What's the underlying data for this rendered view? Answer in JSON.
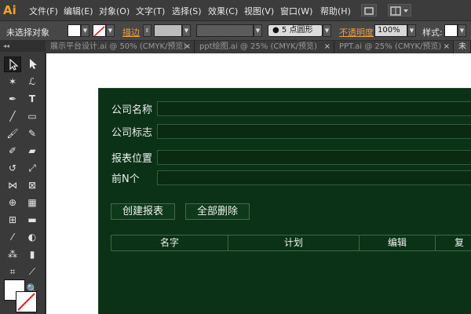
{
  "app": {
    "logo": "Ai"
  },
  "menu": {
    "items": [
      "文件(F)",
      "编辑(E)",
      "对象(O)",
      "文字(T)",
      "选择(S)",
      "效果(C)",
      "视图(V)",
      "窗口(W)",
      "帮助(H)"
    ]
  },
  "control": {
    "no_selection": "未选择对象",
    "stroke_label": "描边",
    "brush_label": "5 点圆形",
    "opacity_label": "不透明度",
    "opacity_value": "100%",
    "style_label": "样式:"
  },
  "tabs": [
    {
      "title": "展示平台设计.ai @ 50% (CMYK/预览)",
      "close": "×"
    },
    {
      "title": "ppt绘图.ai @ 25% (CMYK/预览)",
      "close": "×"
    },
    {
      "title": "PPT.ai @ 25% (CMYK/预览)",
      "close": "×"
    },
    {
      "title": "未"
    }
  ],
  "form": {
    "company_name_label": "公司名称",
    "company_logo_label": "公司标志",
    "report_position_label": "报表位置",
    "top_n_label": "前N个",
    "create_report_button": "创建报表",
    "delete_all_button": "全部删除",
    "columns": [
      "名字",
      "计划",
      "编辑",
      "复"
    ]
  },
  "colors": {
    "panel_bg": "#0b3216",
    "logo": "#f6a41c",
    "accent_label": "#f0a040"
  }
}
